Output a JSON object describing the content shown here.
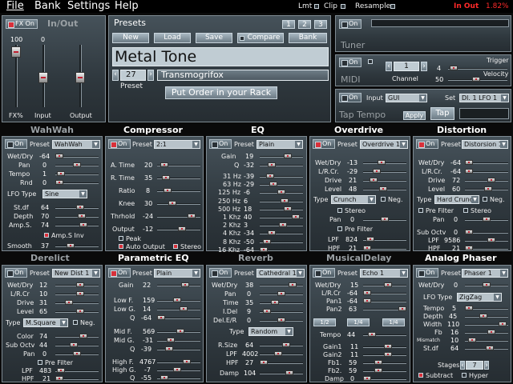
{
  "menu": {
    "file": "File",
    "bank": "Bank",
    "settings": "Settings",
    "help": "Help",
    "lmt": "Lmt",
    "clip": "Clip",
    "resample": "Resample",
    "inout": "In Out",
    "cpu": "1.82%"
  },
  "fx": {
    "on": "FX On",
    "title": "In/Out",
    "v100": "100",
    "v0": "0",
    "fxpct": "FX%",
    "input": "Input",
    "output": "Output"
  },
  "presets": {
    "title": "Presets",
    "b1": "1",
    "b2": "2",
    "b3": "3",
    "new": "New",
    "load": "Load",
    "save": "Save",
    "compare": "Compare",
    "bank": "Bank",
    "name": "Metal Tone",
    "num": "27",
    "numlabel": "Preset",
    "bankname": "Transmogrifox",
    "order": "Put Order in your Rack"
  },
  "tuner": {
    "on": "On",
    "title": "Tuner"
  },
  "midi": {
    "on": "On",
    "title": "MIDI",
    "channel": "1",
    "channel_label": "Channel",
    "trigger": "Trigger",
    "velocity": "Velocity",
    "v4": "4",
    "v50": "50"
  },
  "tap": {
    "on": "On",
    "title": "Tap Tempo",
    "input": "Input",
    "gui": "GUI",
    "set": "Set",
    "setval": "Dl. 1 LFO 1",
    "apply": "Apply",
    "tap": "Tap"
  },
  "wahwah": {
    "title": "WahWah",
    "on": "On",
    "preset": "Preset",
    "sel": "WahWah",
    "l1": "Wet/Dry",
    "v1": "-64",
    "l2": "Pan",
    "v2": "0",
    "l3": "Tempo",
    "v3": "1",
    "l4": "Rnd",
    "v4": "0",
    "lfo": "LFO Type",
    "lfosel": "Sine",
    "l5": "St.df",
    "v5": "64",
    "l6": "Depth",
    "v6": "70",
    "l7": "Amp.S.",
    "v7": "74",
    "ampinv": "Amp.S Inv",
    "l8": "Smooth",
    "v8": "37"
  },
  "comp": {
    "title": "Compressor",
    "on": "On",
    "preset": "Preset",
    "sel": "2:1",
    "l1": "A. Time",
    "v1": "20",
    "l2": "R. Time",
    "v2": "35",
    "l3": "Ratio",
    "v3": "8",
    "l4": "Knee",
    "v4": "30",
    "l5": "Thrhold",
    "v5": "-24",
    "l6": "Output",
    "v6": "-12",
    "peak": "Peak",
    "auto": "Auto Output",
    "stereo": "Stereo"
  },
  "eq": {
    "title": "EQ",
    "on": "On",
    "preset": "Preset",
    "sel": "Plain",
    "l1": "Gain",
    "v1": "19",
    "l2": "Q",
    "v2": "-32",
    "rows": [
      [
        "31 Hz",
        "-39"
      ],
      [
        "63 Hz",
        "-29"
      ],
      [
        "125 Hz",
        "-6"
      ],
      [
        "250 Hz",
        "6"
      ],
      [
        "500 Hz",
        "18"
      ],
      [
        "1 Khz",
        "40"
      ],
      [
        "2 Khz",
        "3"
      ],
      [
        "4 Khz",
        "-34"
      ],
      [
        "8 Khz",
        "-50"
      ],
      [
        "16 Khz",
        "-64"
      ]
    ]
  },
  "od": {
    "title": "Overdrive",
    "on": "On",
    "preset": "Preset",
    "sel": "Overdrive 1",
    "l1": "Wet/Dry",
    "v1": "-13",
    "l2": "L/R.Cr.",
    "v2": "-29",
    "l3": "Drive",
    "v3": "21",
    "l4": "Level",
    "v4": "48",
    "type": "Type",
    "typesel": "Crunch",
    "neg": "Neg.",
    "stereo": "Stereo",
    "pan": "Pan",
    "panv": "0",
    "prefilter": "Pre Filter",
    "lpf": "LPF",
    "lpfv": "824",
    "hpf": "HPF",
    "hpfv": "21"
  },
  "dist": {
    "title": "Distortion",
    "on": "On",
    "preset": "Preset",
    "sel": "Distorsion 1",
    "l1": "Wet/Dry",
    "v1": "-64",
    "l2": "L/R.Cr.",
    "v2": "-64",
    "l3": "Drive",
    "v3": "72",
    "l4": "Level",
    "v4": "60",
    "type": "Type",
    "typesel": "Hard Crunch",
    "neg": "Neg.",
    "prefilter": "Pre Filter",
    "stereo": "Stereo",
    "pan": "Pan",
    "panv": "0",
    "sub": "Sub Octv",
    "subv": "0",
    "lpf": "LPF",
    "lpfv": "9586",
    "hpf": "HPF",
    "hpfv": "21"
  },
  "der": {
    "title": "Derelict",
    "on": "On",
    "preset": "Preset",
    "sel": "New Dist 1",
    "l1": "Wet/Dry",
    "v1": "12",
    "l2": "L/R.Cr",
    "v2": "10",
    "l3": "Drive",
    "v3": "31",
    "l4": "Level",
    "v4": "65",
    "type": "Type",
    "typesel": "M.Square",
    "neg": "Neg.",
    "l5": "Color",
    "v5": "74",
    "l6": "Sub Octv",
    "v6": "44",
    "l7": "Pan",
    "v7": "0",
    "prefilter": "Pre Filter",
    "lpf": "LPF",
    "lpfv": "483",
    "hpf": "HPF",
    "hpfv": "21"
  },
  "peq": {
    "title": "Parametric EQ",
    "on": "On",
    "preset": "Preset",
    "sel": "Plain",
    "l1": "Gain",
    "v1": "22",
    "l2": "Low F.",
    "v2": "159",
    "l3": "Low G.",
    "v3": "14",
    "l4": "Q",
    "v4": "-64",
    "l5": "Mid F.",
    "v5": "569",
    "l6": "Mid G.",
    "v6": "-31",
    "l7": "Q",
    "v7": "-39",
    "l8": "High F.",
    "v8": "4767",
    "l9": "High G.",
    "v9": "-7",
    "l10": "Q",
    "v10": "-55"
  },
  "rev": {
    "title": "Reverb",
    "on": "On",
    "preset": "Preset",
    "sel": "Cathedral 1",
    "l1": "Wet/Dry",
    "v1": "38",
    "l2": "Pan",
    "v2": "0",
    "l3": "Time",
    "v3": "35",
    "l4": "I.Del",
    "v4": "9",
    "l5": "Del.E/R",
    "v5": "0",
    "type": "Type",
    "typesel": "Random",
    "l6": "R.Size",
    "v6": "64",
    "l7": "LPF",
    "v7": "4002",
    "l8": "HPF",
    "v8": "27",
    "l9": "Damp",
    "v9": "104"
  },
  "md": {
    "title": "MusicalDelay",
    "on": "On",
    "preset": "Preset",
    "sel": "Echo 1",
    "l1": "Wet/Dry",
    "v1": "15",
    "l2": "L/R.Cr",
    "v2": "-64",
    "l3": "Pan1",
    "v3": "-64",
    "l4": "Pan2",
    "v4": "63",
    "d1": "1/2",
    "d2": "1/4",
    "d3": "1/4",
    "tempo": "Tempo",
    "tempov": "44",
    "l5": "Gain1",
    "v5": "11",
    "l6": "Gain2",
    "v6": "11",
    "l7": "Fb1.",
    "v7": "59",
    "l8": "Fb2.",
    "v8": "59",
    "l9": "Damp",
    "v9": "0"
  },
  "ap": {
    "title": "Analog Phaser",
    "on": "On",
    "preset": "Preset",
    "sel": "Phaser 1",
    "l1": "Wet/Dry",
    "v1": "0",
    "lfo": "LFO Type",
    "lfosel": "ZigZag",
    "l2": "Tempo",
    "v2": "5",
    "l3": "Depth",
    "v3": "45",
    "l4": "Width",
    "v4": "110",
    "l5": "Fb",
    "v5": "16",
    "l6": "Mismatch",
    "v6": "10",
    "l7": "St.df",
    "v7": "64",
    "stages": "Stages",
    "stagesv": "7",
    "subtract": "Subtract",
    "hyper": "Hyper"
  }
}
